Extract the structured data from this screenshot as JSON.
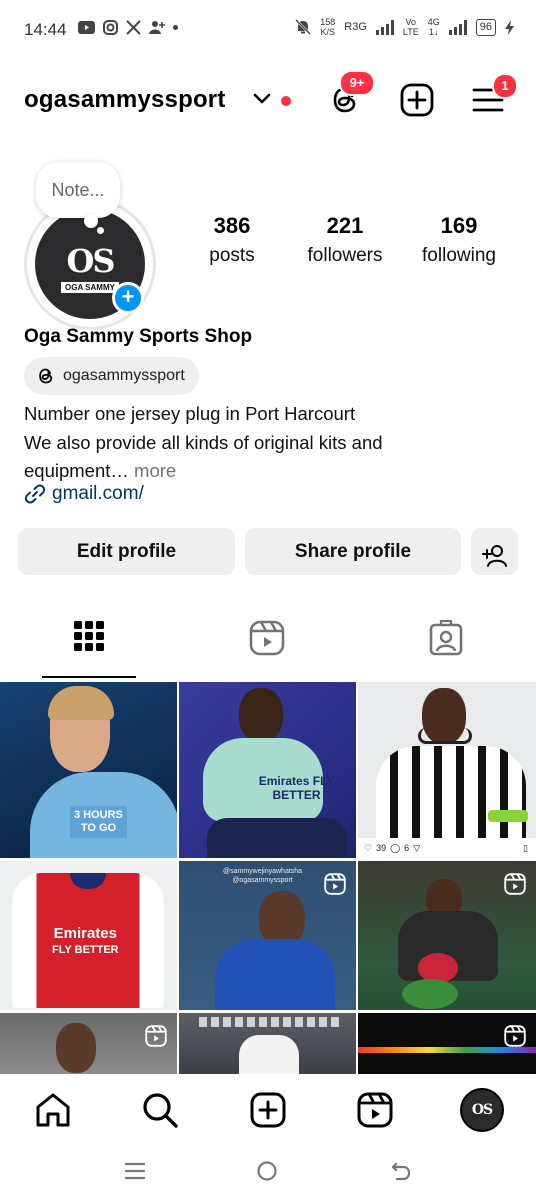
{
  "status_bar": {
    "time": "14:44",
    "speed": "158",
    "speed_unit": "K/S",
    "carrier1": "R3G",
    "carrier2_top": "Vo",
    "carrier2_bottom": "LTE",
    "net_top": "4G",
    "net_bottom": "1↓",
    "battery": "96"
  },
  "header": {
    "username": "ogasammyssport",
    "threads_badge": "9+",
    "menu_badge": "1"
  },
  "profile": {
    "note_placeholder": "Note...",
    "avatar_logo": "OS",
    "avatar_logo_name": "OGA SAMMY",
    "stats": [
      {
        "value": "386",
        "label": "posts"
      },
      {
        "value": "221",
        "label": "followers"
      },
      {
        "value": "169",
        "label": "following"
      }
    ],
    "full_name": "Oga Sammy Sports Shop",
    "threads_handle": "ogasammyssport",
    "bio_line1": "Number one jersey plug in Port Harcourt",
    "bio_line2": "We also provide all kinds of original kits and",
    "bio_line3": "equipment…",
    "bio_more": " more",
    "link": "gmail.com/"
  },
  "buttons": {
    "edit_profile": "Edit profile",
    "share_profile": "Share profile"
  },
  "grid": {
    "post1_text_top": "3 HOURS",
    "post1_text_bottom": "TO GO",
    "post2_text": "Emirates FLY BETTER",
    "post3_likes": "39",
    "post3_comments": "6",
    "post4_text_top": "Emirates",
    "post4_text_bottom": "FLY BETTER",
    "post5_caption_top": "@sammywejinyawhatsha",
    "post5_caption_bottom": "@ogasammyssport"
  },
  "colors": {
    "accent_blue": "#0095f6",
    "badge_red": "#ff3040",
    "link_blue": "#00376b",
    "button_gray": "#efefef"
  }
}
